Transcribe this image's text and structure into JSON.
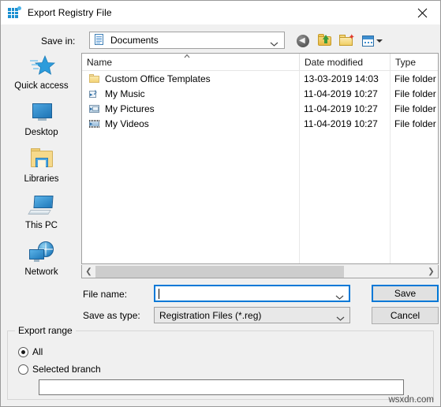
{
  "window": {
    "title": "Export Registry File",
    "icon": "registry-icon",
    "close_label": "×"
  },
  "toolbar": {
    "save_in_label": "Save in:",
    "current_folder": "Documents",
    "folder_icon": "documents-icon",
    "buttons": [
      {
        "name": "back-button",
        "icon": "back-arrow-icon"
      },
      {
        "name": "up-one-level-button",
        "icon": "folder-up-icon"
      },
      {
        "name": "new-folder-button",
        "icon": "new-folder-icon"
      },
      {
        "name": "views-button",
        "icon": "views-icon"
      }
    ]
  },
  "places": {
    "items": [
      {
        "label": "Quick access",
        "icon": "star-icon"
      },
      {
        "label": "Desktop",
        "icon": "monitor-icon"
      },
      {
        "label": "Libraries",
        "icon": "libraries-folder-icon"
      },
      {
        "label": "This PC",
        "icon": "computer-icon"
      },
      {
        "label": "Network",
        "icon": "network-globe-icon"
      }
    ]
  },
  "filelist": {
    "columns": [
      "Name",
      "Date modified",
      "Type"
    ],
    "sort_indicator": "▲",
    "rows": [
      {
        "name": "Custom Office Templates",
        "date": "13-03-2019 14:03",
        "type": "File folder",
        "icon": "folder-icon"
      },
      {
        "name": "My Music",
        "date": "11-04-2019 10:27",
        "type": "File folder",
        "icon": "music-folder-icon"
      },
      {
        "name": "My Pictures",
        "date": "11-04-2019 10:27",
        "type": "File folder",
        "icon": "pictures-folder-icon"
      },
      {
        "name": "My Videos",
        "date": "11-04-2019 10:27",
        "type": "File folder",
        "icon": "videos-folder-icon"
      }
    ],
    "scroll_left_arrow": "❮",
    "scroll_right_arrow": "❯"
  },
  "form": {
    "file_name_label": "File name:",
    "file_name_value": "",
    "file_name_placeholder": "",
    "save_as_type_label": "Save as type:",
    "save_as_type_value": "Registration Files (*.reg)",
    "save_button": "Save",
    "cancel_button": "Cancel"
  },
  "export_range": {
    "title": "Export range",
    "options": [
      {
        "label": "All",
        "selected": true
      },
      {
        "label": "Selected branch",
        "selected": false
      }
    ],
    "branch_value": "",
    "branch_placeholder": ""
  },
  "watermark": "wsxdn.com",
  "colors": {
    "accent": "#0078d7",
    "dialog_bg": "#f0f0f0",
    "field_bg": "#ffffff",
    "disabled_field_bg": "#e8e8e8"
  }
}
